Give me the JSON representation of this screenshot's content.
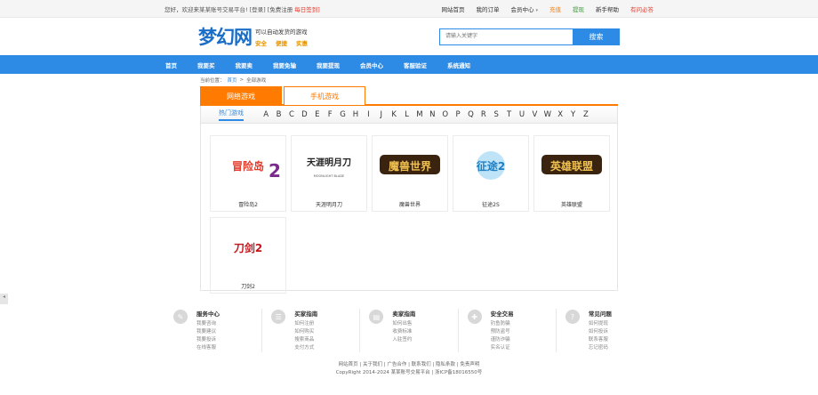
{
  "topbar": {
    "welcome": "您好，欢迎来某某账号交易平台!",
    "login": "[登录]",
    "register": "[免费注册",
    "sign": "每日签到]",
    "links": [
      {
        "label": "网站首页",
        "style": ""
      },
      {
        "label": "我的订单",
        "style": ""
      },
      {
        "label": "会员中心",
        "style": "caret"
      },
      {
        "label": "充值",
        "style": "orange"
      },
      {
        "label": "提现",
        "style": "green"
      },
      {
        "label": "新手帮助",
        "style": ""
      },
      {
        "label": "有问必答",
        "style": "red"
      }
    ]
  },
  "header": {
    "logo": "梦幻网",
    "slogan": "可以自动发货的游戏",
    "badges": [
      "安全",
      "便捷",
      "实惠"
    ],
    "search_placeholder": "请输入关键字",
    "search_button": "搜索"
  },
  "nav": [
    "首页",
    "我要买",
    "我要卖",
    "我要免输",
    "我要提现",
    "会员中心",
    "客服验证",
    "系统通知"
  ],
  "breadcrumb": {
    "prefix": "当前位置：",
    "home": "首页",
    "sep": ">",
    "current": "全部游戏"
  },
  "tabs": [
    "网络游戏",
    "手机游戏"
  ],
  "filter": {
    "hot": "热门游戏",
    "letters": [
      "A",
      "B",
      "C",
      "D",
      "E",
      "F",
      "G",
      "H",
      "I",
      "J",
      "K",
      "L",
      "M",
      "N",
      "O",
      "P",
      "Q",
      "R",
      "S",
      "T",
      "U",
      "V",
      "W",
      "X",
      "Y",
      "Z"
    ]
  },
  "games": [
    {
      "name": "冒险岛2",
      "logo_text": "冒险岛",
      "logo_num": "2",
      "color": "#e23a2b"
    },
    {
      "name": "天涯明月刀",
      "logo_text": "天涯明月刀",
      "logo_sub": "MOONLIGHT BLADE",
      "color": "#222222"
    },
    {
      "name": "魔兽世界",
      "logo_text": "魔兽世界",
      "color": "#c8951e"
    },
    {
      "name": "征途2S",
      "logo_text": "征途2",
      "color": "#1f7fc4"
    },
    {
      "name": "英雄联盟",
      "logo_text": "英雄联盟",
      "color": "#b88a2a"
    },
    {
      "name": "刀剑2",
      "logo_text": "刀剑2",
      "color": "#c4161c"
    }
  ],
  "help": [
    {
      "icon": "✎",
      "icon_name": "pen-icon",
      "title": "服务中心",
      "links": [
        "我要咨询",
        "我要建议",
        "我要投诉",
        "在线客服"
      ]
    },
    {
      "icon": "☰",
      "icon_name": "list-icon",
      "title": "买家指南",
      "links": [
        "如何注册",
        "如何购买",
        "搜索商品",
        "支付方式"
      ]
    },
    {
      "icon": "▤",
      "icon_name": "card-icon",
      "title": "卖家指南",
      "links": [
        "如何出售",
        "收费标准",
        "入驻签约"
      ]
    },
    {
      "icon": "✚",
      "icon_name": "shield-icon",
      "title": "安全交易",
      "links": [
        "钓鱼防骗",
        "预防盗号",
        "谨防诈骗",
        "实名认证"
      ]
    },
    {
      "icon": "?",
      "icon_name": "question-icon",
      "title": "常见问题",
      "links": [
        "如何提现",
        "如何投诉",
        "联系客服",
        "忘记密码"
      ]
    }
  ],
  "footer": {
    "links": "网站首页 | 关于我们 | 广告合作 | 联系我们 | 隐私条款 | 免责声明",
    "copyright": "CopyRight 2014-2024 某某账号交易平台 | 浙ICP备18016550号"
  },
  "side_tab": "◂"
}
